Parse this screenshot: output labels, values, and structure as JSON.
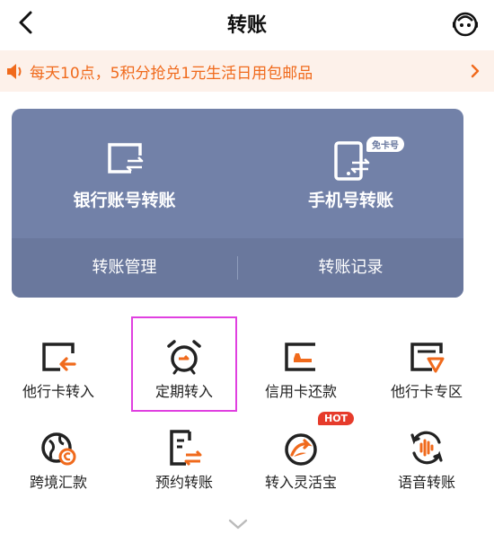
{
  "header": {
    "title": "转账",
    "back_icon": "chevron-left-icon",
    "support_icon": "robot-icon"
  },
  "notice": {
    "text": "每天10点，5积分抢兑1元生活日用包邮品",
    "icon": "speaker-icon",
    "color": "#f06a1c"
  },
  "card": {
    "bank_transfer": "银行账号转账",
    "phone_transfer": "手机号转账",
    "phone_badge": "免卡号",
    "manage": "转账管理",
    "records": "转账记录",
    "color": "#7281a8"
  },
  "grid": [
    {
      "label": "他行卡转入",
      "icon": "card-arrow-in-icon"
    },
    {
      "label": "定期转入",
      "icon": "alarm-clock-icon"
    },
    {
      "label": "信用卡还款",
      "icon": "credit-card-icon"
    },
    {
      "label": "他行卡专区",
      "icon": "card-shield-icon"
    },
    {
      "label": "跨境汇款",
      "icon": "globe-exchange-icon"
    },
    {
      "label": "预约转账",
      "icon": "scheduled-transfer-icon"
    },
    {
      "label": "转入灵活宝",
      "icon": "flexible-treasure-icon",
      "badge": "HOT"
    },
    {
      "label": "语音转账",
      "icon": "voice-transfer-icon"
    }
  ],
  "more_icon": "chevron-down-icon",
  "accent": "#f06a1c"
}
